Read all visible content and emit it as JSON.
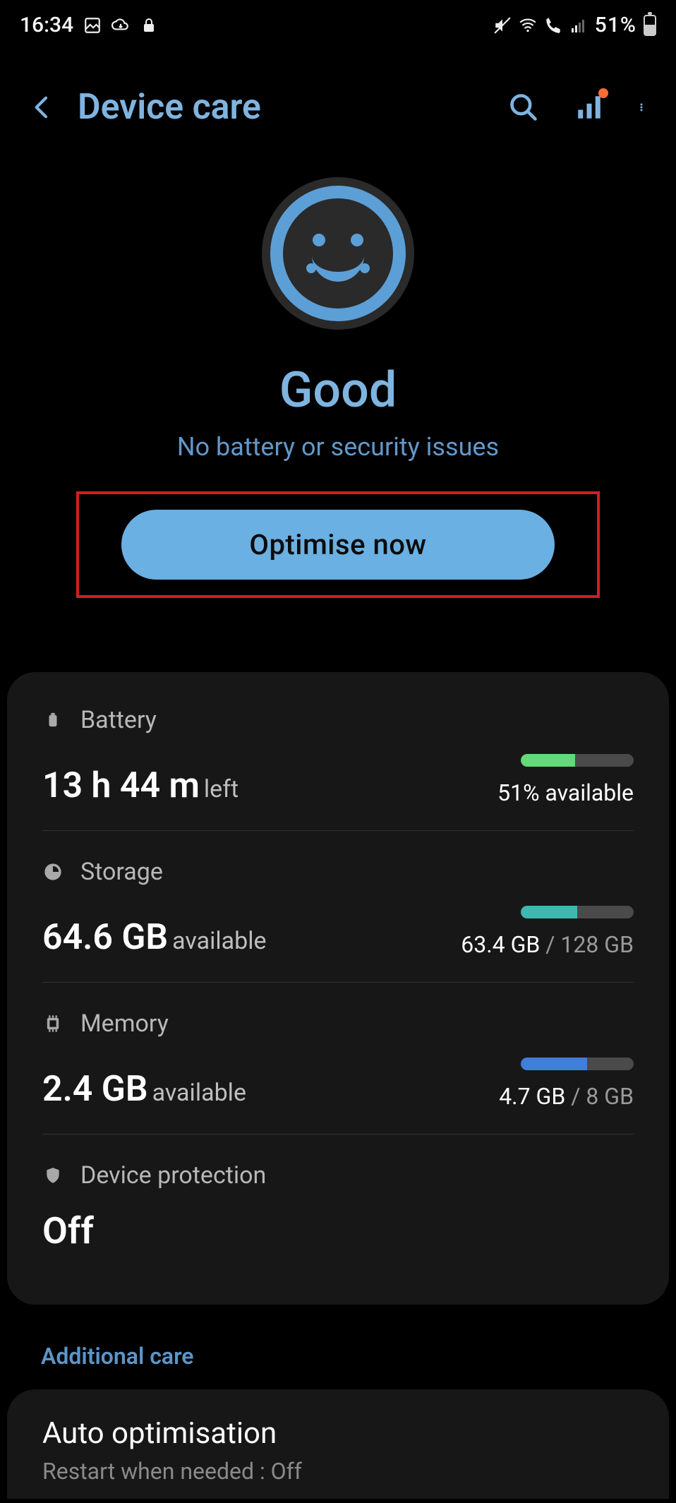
{
  "status_bar": {
    "time": "16:34",
    "battery_pct": "51%"
  },
  "header": {
    "title": "Device care"
  },
  "hero": {
    "status": "Good",
    "subtitle": "No battery or security issues",
    "button": "Optimise now"
  },
  "battery": {
    "label": "Battery",
    "value": "13 h 44 m",
    "unit": "left",
    "available": "51% available"
  },
  "storage": {
    "label": "Storage",
    "value": "64.6 GB",
    "unit": "available",
    "used": "63.4 GB",
    "total": "128 GB"
  },
  "memory": {
    "label": "Memory",
    "value": "2.4 GB",
    "unit": "available",
    "used": "4.7 GB",
    "total": "8 GB"
  },
  "protection": {
    "label": "Device protection",
    "value": "Off"
  },
  "additional": {
    "section": "Additional care",
    "auto_opt_title": "Auto optimisation",
    "auto_opt_sub": "Restart when needed : Off"
  }
}
